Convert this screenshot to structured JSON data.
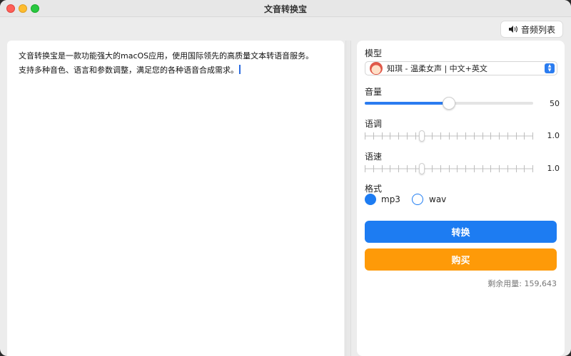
{
  "window": {
    "title": "文音转换宝"
  },
  "toolbar": {
    "audio_list_label": "音频列表"
  },
  "editor": {
    "text": "文音转换宝是一款功能强大的macOS应用，使用国际领先的高质量文本转语音服务。\n支持多种音色、语言和参数调整，满足您的各种语音合成需求。"
  },
  "panel": {
    "model_label": "模型",
    "model_value": "知琪 - 温柔女声 | 中文+英文",
    "volume_label": "音量",
    "volume_value": "50",
    "volume_level": 0.5,
    "pitch_label": "语调",
    "pitch_value": "1.0",
    "speed_label": "语速",
    "speed_value": "1.0",
    "format_label": "格式",
    "formats": [
      "mp3",
      "wav"
    ],
    "selected_format": "mp3",
    "convert_label": "转换",
    "buy_label": "购买",
    "remaining": "剩余用量: 159,643"
  },
  "colors": {
    "accent_blue": "#1d7cf2",
    "buy_orange": "#fe9a08"
  },
  "icons": {
    "speaker": "speaker-icon",
    "avatar": "avatar",
    "select_arrows": "chevron-updown-icon"
  }
}
